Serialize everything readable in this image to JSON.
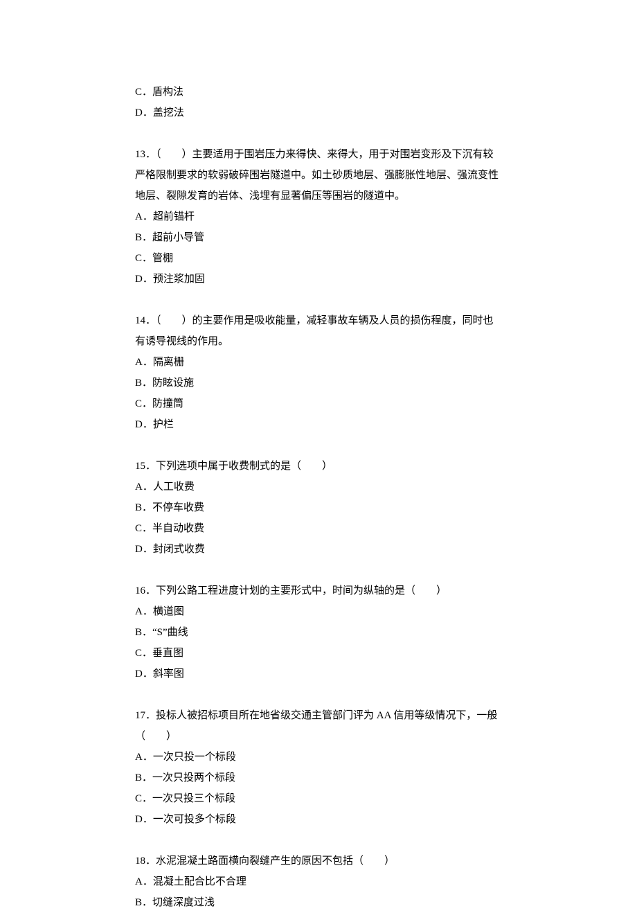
{
  "orphan_options": [
    "C．盾构法",
    "D．盖挖法"
  ],
  "questions": [
    {
      "stem": "13．（　　）主要适用于围岩压力来得快、来得大，用于对围岩变形及下沉有较严格限制要求的软弱破碎围岩隧道中。如土砂质地层、强膨胀性地层、强流变性地层、裂隙发育的岩体、浅埋有显著偏压等围岩的隧道中。",
      "options": [
        "A．超前锚杆",
        "B．超前小导管",
        "C．管棚",
        "D．预注浆加固"
      ]
    },
    {
      "stem": "14．（　　）的主要作用是吸收能量，减轻事故车辆及人员的损伤程度，同时也有诱导视线的作用。",
      "options": [
        "A．隔离栅",
        "B．防眩设施",
        "C．防撞筒",
        "D．护栏"
      ]
    },
    {
      "stem": "15．下列选项中属于收费制式的是（　　）",
      "options": [
        "A．人工收费",
        "B．不停车收费",
        "C．半自动收费",
        "D．封闭式收费"
      ]
    },
    {
      "stem": "16．下列公路工程进度计划的主要形式中，时间为纵轴的是（　　）",
      "options": [
        "A．横道图",
        "B．“S”曲线",
        "C．垂直图",
        "D．斜率图"
      ]
    },
    {
      "stem": "17．投标人被招标项目所在地省级交通主管部门评为 AA 信用等级情况下，一般（　　）",
      "options": [
        "A．一次只投一个标段",
        "B．一次只投两个标段",
        "C．一次只投三个标段",
        "D．一次可投多个标段"
      ]
    },
    {
      "stem": "18．水泥混凝土路面横向裂缝产生的原因不包括（　　）",
      "options": [
        "A．混凝土配合比不合理",
        "B．切缝深度过浅"
      ]
    }
  ]
}
